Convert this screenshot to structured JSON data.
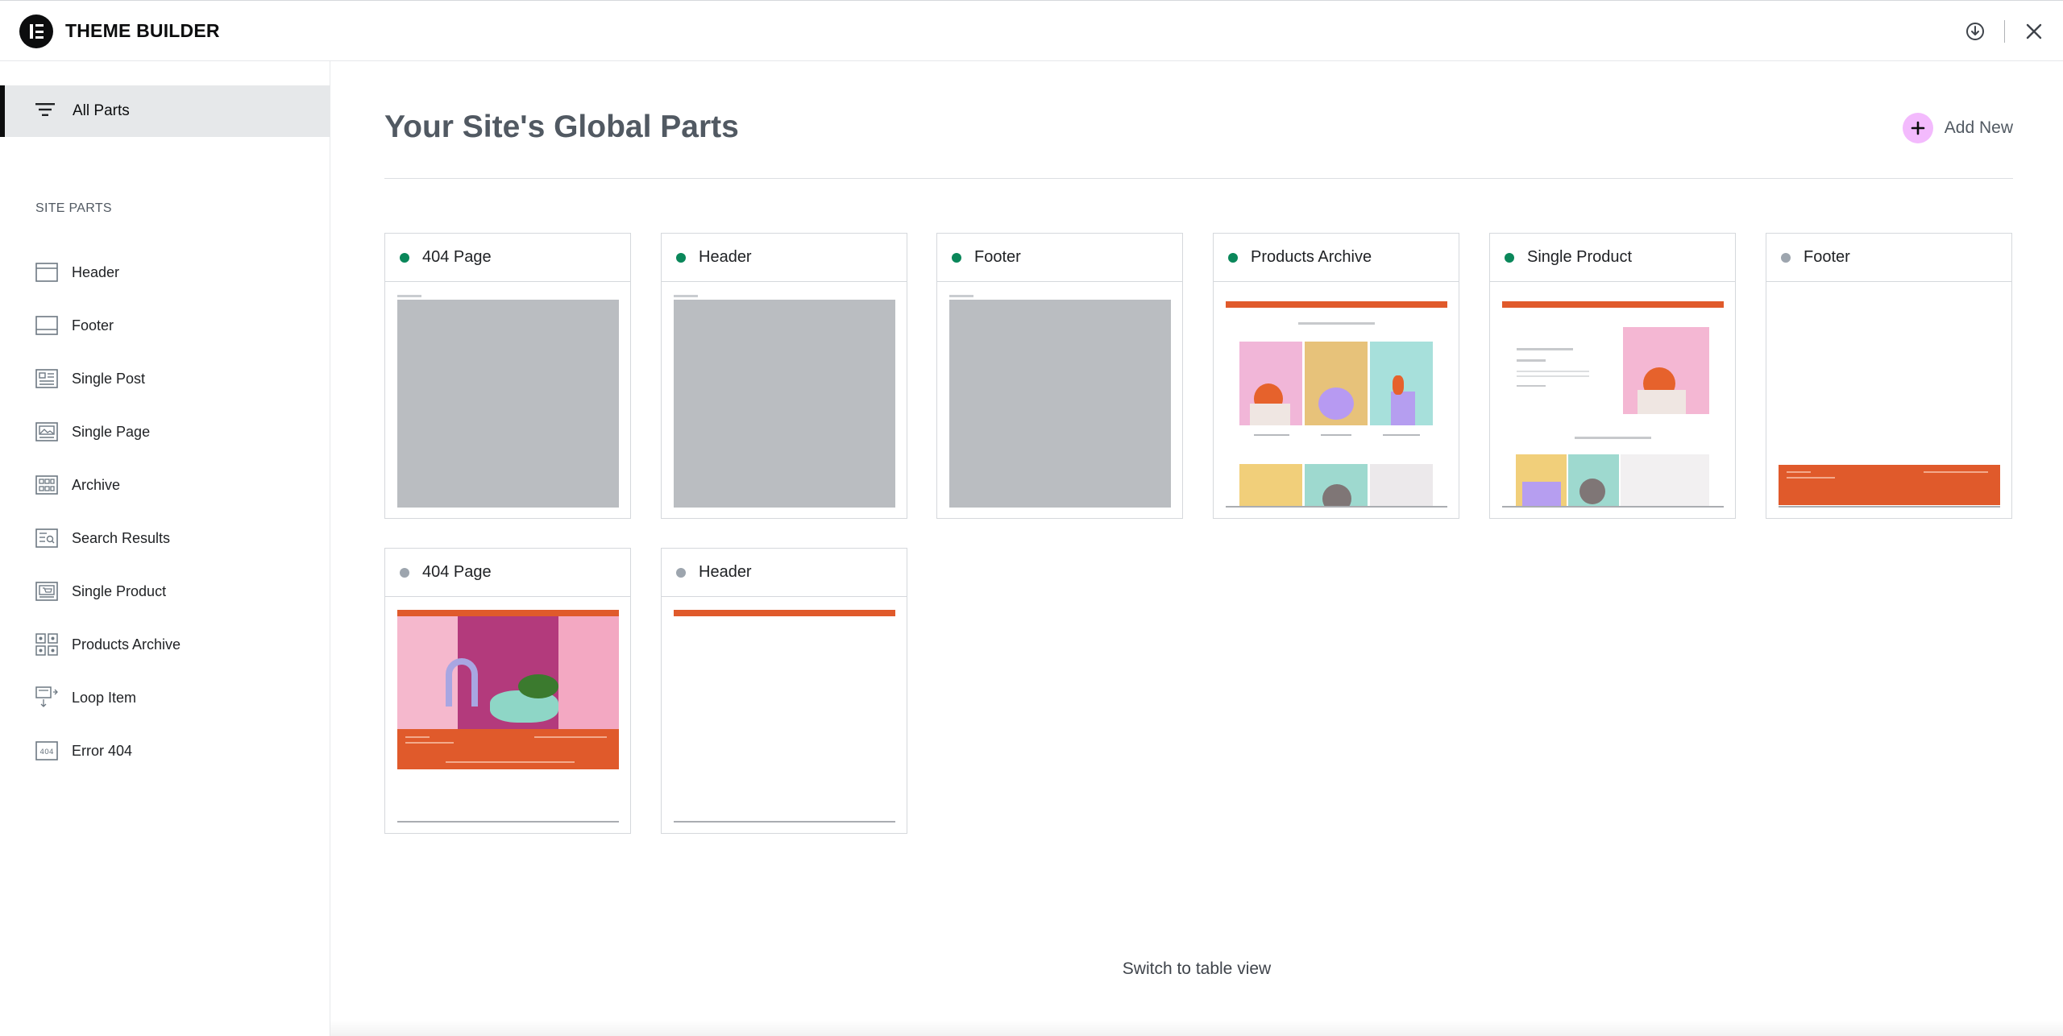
{
  "app": {
    "title": "THEME BUILDER"
  },
  "top_actions": [
    {
      "icon": "download-icon"
    },
    {
      "icon": "close-icon"
    }
  ],
  "sidebar": {
    "all_parts_label": "All Parts",
    "section_heading": "SITE PARTS",
    "items": [
      {
        "label": "Header",
        "icon": "header-icon"
      },
      {
        "label": "Footer",
        "icon": "footer-icon"
      },
      {
        "label": "Single Post",
        "icon": "single-post-icon"
      },
      {
        "label": "Single Page",
        "icon": "single-page-icon"
      },
      {
        "label": "Archive",
        "icon": "archive-icon"
      },
      {
        "label": "Search Results",
        "icon": "search-results-icon"
      },
      {
        "label": "Single Product",
        "icon": "single-product-icon"
      },
      {
        "label": "Products Archive",
        "icon": "products-archive-icon"
      },
      {
        "label": "Loop Item",
        "icon": "loop-item-icon"
      },
      {
        "label": "Error 404",
        "icon": "error-404-icon"
      }
    ]
  },
  "main": {
    "title": "Your Site's Global Parts",
    "add_new_label": "Add New",
    "switch_view_label": "Switch to table view",
    "cards": [
      {
        "name": "404 Page",
        "status": "active",
        "thumbnail": "gray-placeholder"
      },
      {
        "name": "Header",
        "status": "active",
        "thumbnail": "gray-placeholder"
      },
      {
        "name": "Footer",
        "status": "active",
        "thumbnail": "gray-placeholder"
      },
      {
        "name": "Products Archive",
        "status": "active",
        "thumbnail": "products-archive-preview"
      },
      {
        "name": "Single Product",
        "status": "active",
        "thumbnail": "single-product-preview"
      },
      {
        "name": "Footer",
        "status": "draft",
        "thumbnail": "footer-preview"
      },
      {
        "name": "404 Page",
        "status": "draft",
        "thumbnail": "404-page-preview"
      },
      {
        "name": "Header",
        "status": "draft",
        "thumbnail": "header-preview"
      }
    ]
  },
  "colors": {
    "accent_pink": "#f3bafd",
    "status_active": "#0a875a",
    "status_draft": "#9da5ae",
    "brand_orange": "#e05a2b"
  }
}
